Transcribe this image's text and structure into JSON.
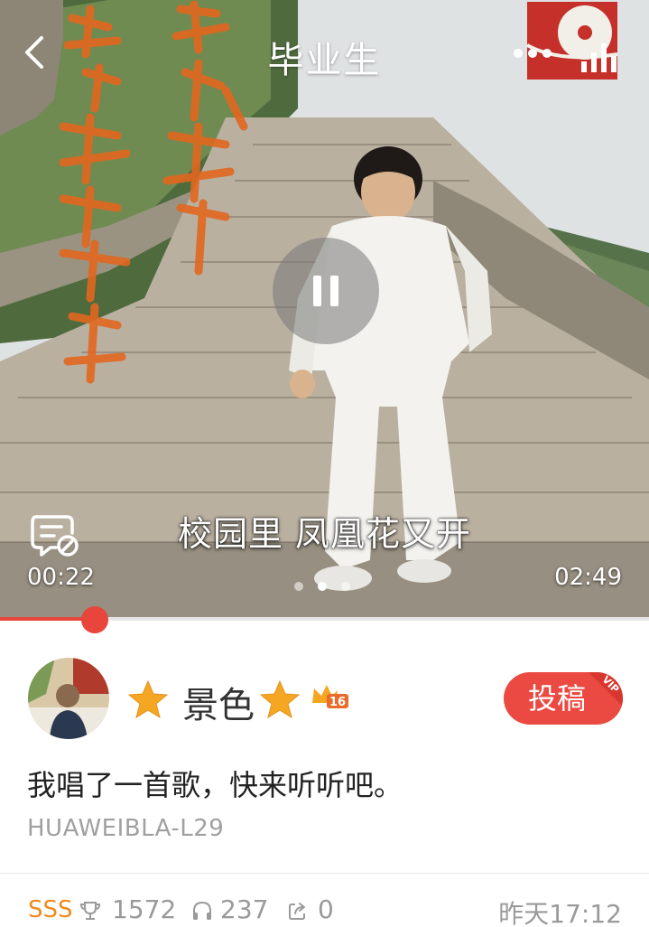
{
  "header": {
    "title": "毕业生"
  },
  "player": {
    "lyric": "校园里 凤凰花又开",
    "current_time": "00:22",
    "total_time": "02:49",
    "progress": 0.146,
    "page_count": 3,
    "active_page": 2
  },
  "user": {
    "name": "景色",
    "level": "16"
  },
  "submit_button": {
    "label": "投稿",
    "ribbon": "VIP"
  },
  "post": {
    "description": "我唱了一首歌，快来听听吧。",
    "device": "HUAWEIBLA-L29"
  },
  "stats": {
    "grade": "SSS",
    "trophy_count": "1572",
    "listen_count": "237",
    "share_count": "0",
    "timestamp": "昨天17:12"
  },
  "colors": {
    "accent": "#ea4a42",
    "progress": "#e8453c",
    "grade": "#f08a1c",
    "star": "#f5a623"
  },
  "icons": [
    "back-icon",
    "more-icon",
    "bars-icon",
    "pause-icon",
    "danmaku-icon",
    "star-icon",
    "crown-badge-icon",
    "trophy-icon",
    "headphone-icon",
    "share-icon"
  ]
}
